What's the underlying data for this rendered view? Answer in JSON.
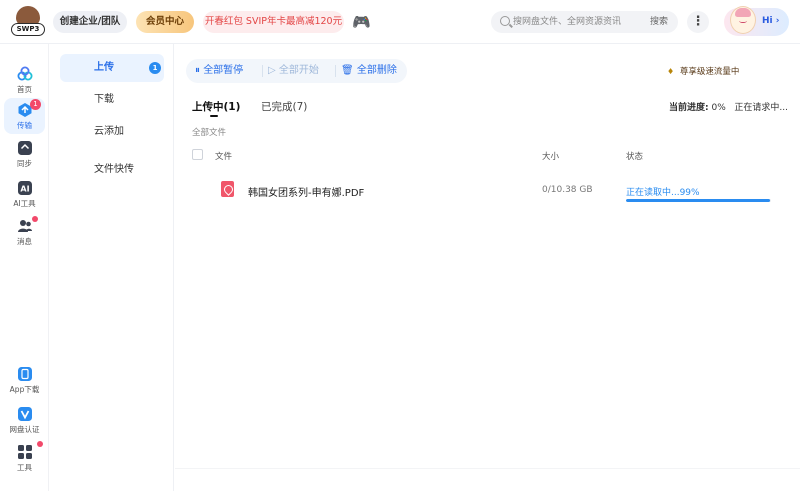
{
  "header": {
    "logo_text": "SWP3",
    "team_label": "创建企业/团队",
    "vip_label": "会员中心",
    "promo_label": "开春红包 SVIP年卡最高减120元",
    "search_placeholder": "搜网盘文件、全网资源资讯",
    "search_button": "搜索",
    "more_label": "⋮",
    "hi_label": "Hi ›",
    "colors": {
      "accent": "#2a6fe8",
      "promo": "#e34545",
      "vip": "#f7c67d"
    }
  },
  "rail": {
    "items": [
      {
        "label": "首页",
        "icon": "home-cloud-icon"
      },
      {
        "label": "传输",
        "icon": "transfer-icon",
        "badge": "1"
      },
      {
        "label": "同步",
        "icon": "sync-icon"
      },
      {
        "label": "AI工具",
        "icon": "ai-tool-icon"
      },
      {
        "label": "消息",
        "icon": "message-icon"
      }
    ],
    "bottom_items": [
      {
        "label": "App下载",
        "icon": "phone-icon"
      },
      {
        "label": "网盘认证",
        "icon": "verify-shield-icon"
      },
      {
        "label": "工具",
        "icon": "grid-tools-icon"
      }
    ]
  },
  "subnav": {
    "items": [
      {
        "label": "上传",
        "badge": "1"
      },
      {
        "label": "下载"
      },
      {
        "label": "云添加"
      },
      {
        "label": "文件快传"
      }
    ]
  },
  "toolbar": {
    "pause_all": "全部暂停",
    "start_all": "全部开始",
    "delete_all": "全部删除"
  },
  "speed_label": "尊享级速流量中",
  "tabs": {
    "uploading": "上传中(1)",
    "completed": "已完成(7)"
  },
  "progress": {
    "label": "当前进度:",
    "value": "0%",
    "status": "正在请求中..."
  },
  "breadcrumb": "全部文件",
  "table": {
    "headers": {
      "file": "文件",
      "size": "大小",
      "status": "状态"
    },
    "rows": [
      {
        "name": "韩国女团系列-申有娜.PDF",
        "size": "0/10.38 GB",
        "status": "正在读取中...99%",
        "progress": 0.99
      }
    ]
  }
}
